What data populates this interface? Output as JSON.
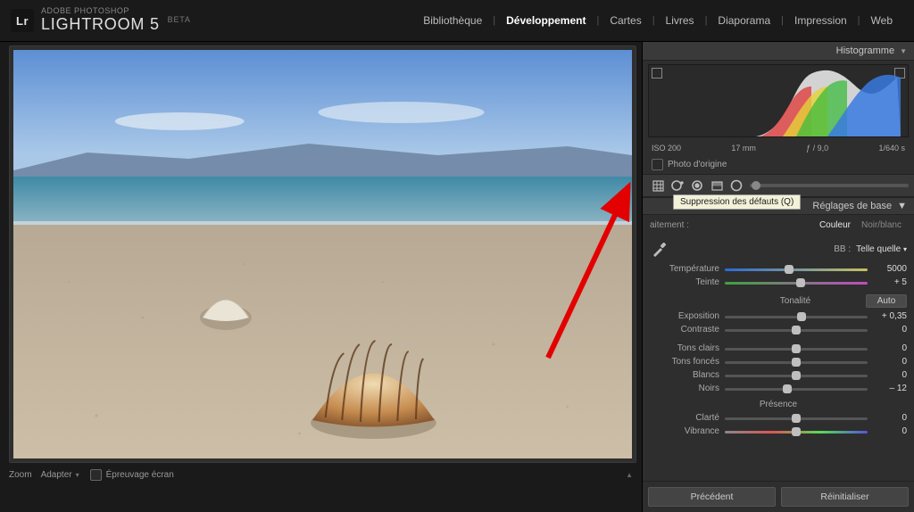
{
  "header": {
    "brand": "ADOBE PHOTOSHOP",
    "product": "LIGHTROOM 5",
    "beta": "BETA"
  },
  "nav": {
    "tabs": [
      {
        "label": "Bibliothèque"
      },
      {
        "label": "Développement",
        "active": true
      },
      {
        "label": "Cartes"
      },
      {
        "label": "Livres"
      },
      {
        "label": "Diaporama"
      },
      {
        "label": "Impression"
      },
      {
        "label": "Web"
      }
    ]
  },
  "footer": {
    "zoom": "Zoom",
    "fit": "Adapter",
    "softproof": "Épreuvage écran"
  },
  "right": {
    "histogram": "Histogramme",
    "meta": {
      "iso": "ISO 200",
      "focal": "17 mm",
      "aperture": "ƒ / 9,0",
      "shutter": "1/640 s"
    },
    "original": "Photo d'origine",
    "tooltip": "Suppression des défauts (Q)",
    "basic_title": "Réglages de base",
    "treatment": {
      "label": "aitement :",
      "color": "Couleur",
      "bw": "Noir/blanc"
    },
    "wb": {
      "label": "BB :",
      "value": "Telle quelle"
    },
    "sliders": {
      "temp": {
        "label": "Température",
        "value": "5000",
        "pos": 0.45,
        "gradient": "linear-gradient(90deg,#2a6bd6,#c8c060)"
      },
      "tint": {
        "label": "Teinte",
        "value": "+ 5",
        "pos": 0.53,
        "gradient": "linear-gradient(90deg,#3fa33f,#c24bc2)"
      },
      "tone_title": "Tonalité",
      "auto": "Auto",
      "expo": {
        "label": "Exposition",
        "value": "+ 0,35",
        "pos": 0.54,
        "gradient": "#555"
      },
      "contrast": {
        "label": "Contraste",
        "value": "0",
        "pos": 0.5,
        "gradient": "#555"
      },
      "highlights": {
        "label": "Tons clairs",
        "value": "0",
        "pos": 0.5,
        "gradient": "#555"
      },
      "shadows": {
        "label": "Tons foncés",
        "value": "0",
        "pos": 0.5,
        "gradient": "#555"
      },
      "whites": {
        "label": "Blancs",
        "value": "0",
        "pos": 0.5,
        "gradient": "#555"
      },
      "blacks": {
        "label": "Noirs",
        "value": "– 12",
        "pos": 0.44,
        "gradient": "#555"
      },
      "presence_title": "Présence",
      "clarity": {
        "label": "Clarté",
        "value": "0",
        "pos": 0.5,
        "gradient": "#555"
      },
      "vibrance": {
        "label": "Vibrance",
        "value": "0",
        "pos": 0.5,
        "gradient": "linear-gradient(90deg,#888,#d55,#5d5,#55d)"
      }
    },
    "buttons": {
      "prev": "Précédent",
      "reset": "Réinitialiser"
    }
  }
}
